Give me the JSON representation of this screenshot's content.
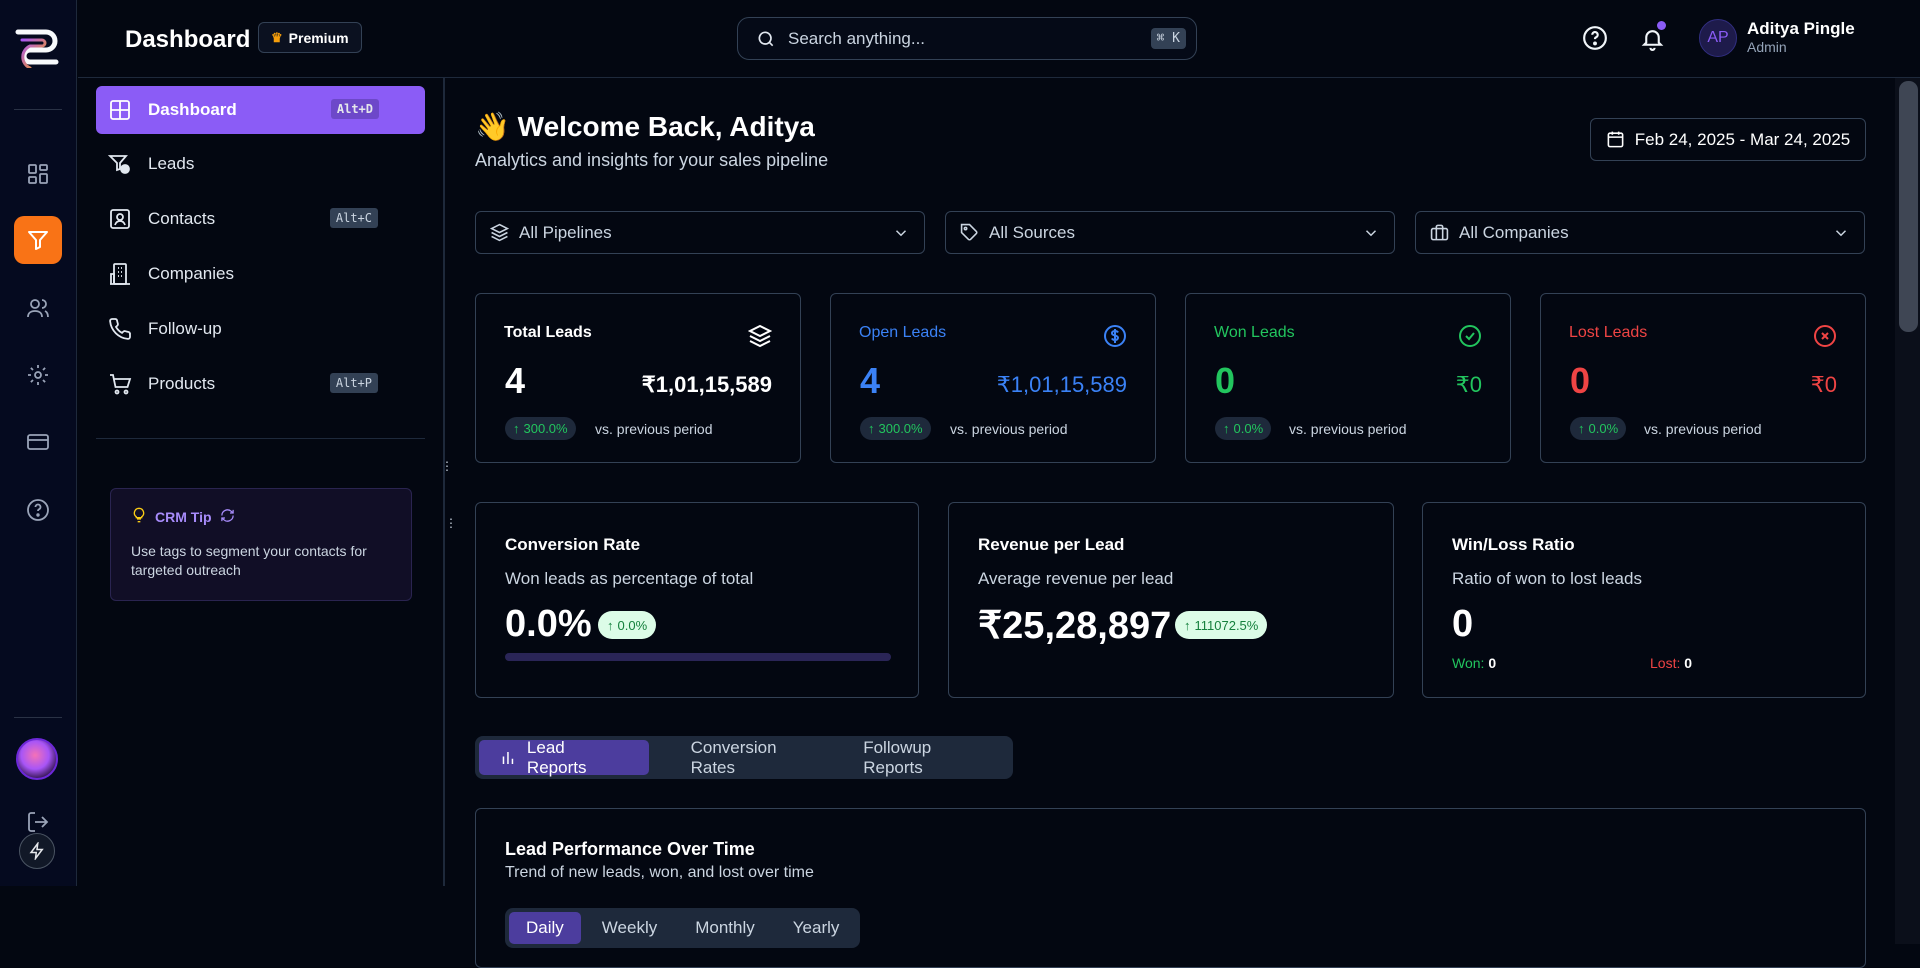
{
  "header": {
    "title": "Dashboard",
    "premium_label": "Premium",
    "search_placeholder": "Search anything...",
    "search_shortcut": "⌘ K",
    "user_initials": "AP",
    "user_name": "Aditya Pingle",
    "user_role": "Admin"
  },
  "rail": {
    "items": [
      "grid-icon",
      "funnel-icon",
      "users-icon",
      "settings-icon",
      "card-icon",
      "help-icon",
      "logout-icon",
      "bolt-icon"
    ]
  },
  "sidebar": {
    "items": [
      {
        "label": "Dashboard",
        "shortcut": "Alt+D"
      },
      {
        "label": "Leads",
        "shortcut": ""
      },
      {
        "label": "Contacts",
        "shortcut": "Alt+C"
      },
      {
        "label": "Companies",
        "shortcut": ""
      },
      {
        "label": "Follow-up",
        "shortcut": ""
      },
      {
        "label": "Products",
        "shortcut": "Alt+P"
      }
    ],
    "tip": {
      "title": "CRM Tip",
      "body": "Use tags to segment your contacts for targeted outreach"
    }
  },
  "main": {
    "welcome": "Welcome Back, Aditya",
    "welcome_emoji": "👋",
    "subtitle": "Analytics and insights for your sales pipeline",
    "date_range": "Feb 24, 2025 - Mar 24, 2025",
    "filters": [
      "All Pipelines",
      "All Sources",
      "All Companies"
    ],
    "stats": [
      {
        "label": "Total Leads",
        "count": "4",
        "amount": "₹1,01,15,589",
        "delta": "300.0%",
        "vs": "vs. previous period",
        "color": "#ffffff"
      },
      {
        "label": "Open Leads",
        "count": "4",
        "amount": "₹1,01,15,589",
        "delta": "300.0%",
        "vs": "vs. previous period",
        "color": "#3b82f6"
      },
      {
        "label": "Won Leads",
        "count": "0",
        "amount": "₹0",
        "delta": "0.0%",
        "vs": "vs. previous period",
        "color": "#22c55e"
      },
      {
        "label": "Lost Leads",
        "count": "0",
        "amount": "₹0",
        "delta": "0.0%",
        "vs": "vs. previous period",
        "color": "#ef4444"
      }
    ],
    "metrics": {
      "conversion": {
        "title": "Conversion Rate",
        "desc": "Won leads as percentage of total",
        "value": "0.0%",
        "delta": "0.0%",
        "progress": 0.0
      },
      "revenue": {
        "title": "Revenue per Lead",
        "desc": "Average revenue per lead",
        "value": "₹25,28,897",
        "delta": "111072.5%"
      },
      "winloss": {
        "title": "Win/Loss Ratio",
        "desc": "Ratio of won to lost leads",
        "value": "0",
        "won_label": "Won:",
        "won_value": "0",
        "lost_label": "Lost:",
        "lost_value": "0"
      }
    },
    "report_tabs": [
      "Lead Reports",
      "Conversion Rates",
      "Followup Reports"
    ],
    "performance": {
      "title": "Lead Performance Over Time",
      "desc": "Trend of new leads, won, and lost over time",
      "ranges": [
        "Daily",
        "Weekly",
        "Monthly",
        "Yearly"
      ]
    }
  },
  "colors": {
    "accent": "#8b5cf6",
    "rail_active": "#f97316",
    "success": "#22c55e",
    "danger": "#ef4444",
    "info": "#3b82f6"
  }
}
